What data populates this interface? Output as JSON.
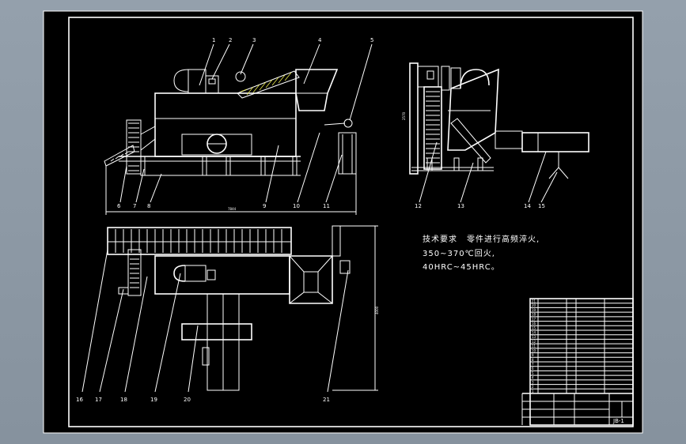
{
  "drawing": {
    "tech_req_title": "技术要求",
    "tech_req_lines": [
      "零件进行高频淬火,",
      "350~370℃回火,",
      "40HRC~45HRC。"
    ],
    "front_dim": "7844",
    "side_dim": "2570",
    "plan_dim": "4000",
    "drawing_no": "JB-1"
  },
  "balloons": {
    "top": [
      "1",
      "2",
      "3",
      "4",
      "5"
    ],
    "front_bottom": [
      "6",
      "7",
      "8",
      "9",
      "10",
      "11"
    ],
    "side_bottom": [
      "12",
      "13",
      "14",
      "15"
    ],
    "plan_bottom": [
      "16",
      "17",
      "18",
      "19",
      "20",
      "21"
    ]
  },
  "title_block": {
    "row_numbers": [
      "21",
      "20",
      "19",
      "18",
      "17",
      "16",
      "15",
      "14",
      "13",
      "12",
      "11",
      "10",
      "9",
      "8",
      "7",
      "6",
      "5",
      "4",
      "3",
      "2",
      "1"
    ]
  },
  "colors": {
    "sheet": "#000000",
    "line": "#ffffff",
    "center": "#40e0e0",
    "hidden": "#e8e84a",
    "background": "#8e9aa6"
  }
}
